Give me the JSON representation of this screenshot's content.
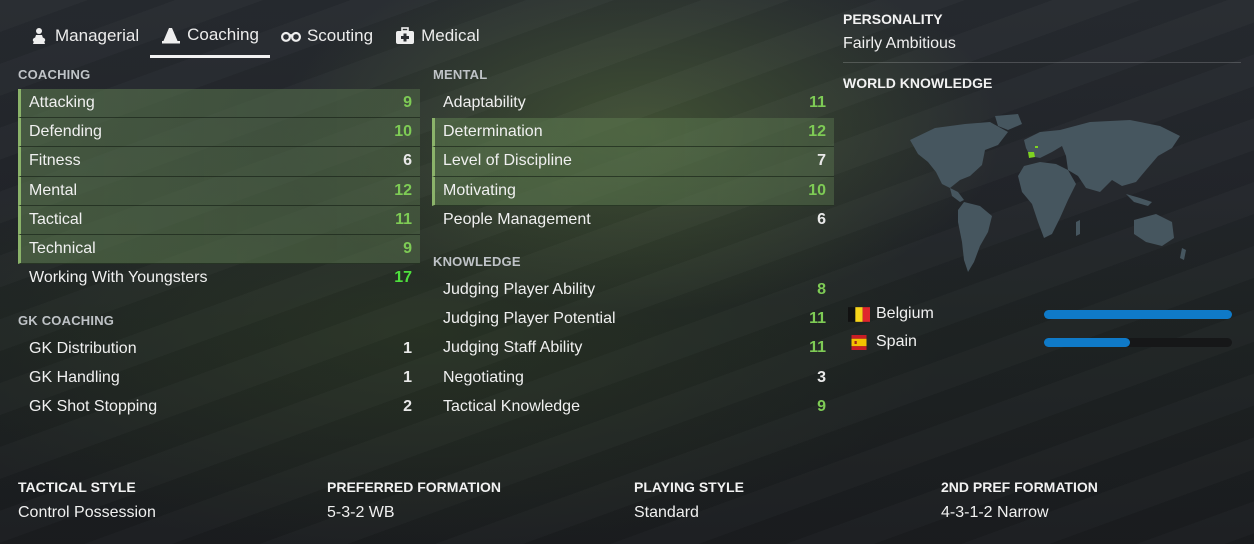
{
  "tabs": [
    {
      "label": "Managerial",
      "icon": "manager-icon"
    },
    {
      "label": "Coaching",
      "icon": "whistle-icon",
      "active": true
    },
    {
      "label": "Scouting",
      "icon": "binoculars-icon"
    },
    {
      "label": "Medical",
      "icon": "medical-kit-icon"
    }
  ],
  "coaching": {
    "title": "COACHING",
    "items": [
      {
        "name": "Attacking",
        "value": "9"
      },
      {
        "name": "Defending",
        "value": "10"
      },
      {
        "name": "Fitness",
        "value": "6"
      },
      {
        "name": "Mental",
        "value": "12"
      },
      {
        "name": "Tactical",
        "value": "11"
      },
      {
        "name": "Technical",
        "value": "9"
      },
      {
        "name": "Working With Youngsters",
        "value": "17"
      }
    ]
  },
  "gk_coaching": {
    "title": "GK COACHING",
    "items": [
      {
        "name": "GK Distribution",
        "value": "1"
      },
      {
        "name": "GK Handling",
        "value": "1"
      },
      {
        "name": "GK Shot Stopping",
        "value": "2"
      }
    ]
  },
  "mental": {
    "title": "MENTAL",
    "items": [
      {
        "name": "Adaptability",
        "value": "11"
      },
      {
        "name": "Determination",
        "value": "12"
      },
      {
        "name": "Level of Discipline",
        "value": "7"
      },
      {
        "name": "Motivating",
        "value": "10"
      },
      {
        "name": "People Management",
        "value": "6"
      }
    ]
  },
  "knowledge": {
    "title": "KNOWLEDGE",
    "items": [
      {
        "name": "Judging Player Ability",
        "value": "8"
      },
      {
        "name": "Judging Player Potential",
        "value": "11"
      },
      {
        "name": "Judging Staff Ability",
        "value": "11"
      },
      {
        "name": "Negotiating",
        "value": "3"
      },
      {
        "name": "Tactical Knowledge",
        "value": "9"
      }
    ]
  },
  "personality": {
    "label": "PERSONALITY",
    "value": "Fairly Ambitious"
  },
  "world_knowledge": {
    "label": "WORLD KNOWLEDGE",
    "countries": [
      {
        "name": "Belgium",
        "level": 1.0,
        "flag": "belgium-flag"
      },
      {
        "name": "Spain",
        "level": 0.46,
        "flag": "spain-flag"
      }
    ]
  },
  "bottom": [
    {
      "label": "TACTICAL STYLE",
      "value": "Control Possession"
    },
    {
      "label": "PREFERRED FORMATION",
      "value": "5-3-2 WB"
    },
    {
      "label": "PLAYING STYLE",
      "value": "Standard"
    },
    {
      "label": "2ND PREF FORMATION",
      "value": "4-3-1-2 Narrow"
    }
  ],
  "colors": {
    "highlight_row": "#5f8052",
    "value_green": "#7ecb55",
    "value_top": "#4ee03d",
    "bar": "#0f7ac8",
    "map_land": "#4a5a66",
    "map_highlight": "#7ed321"
  }
}
